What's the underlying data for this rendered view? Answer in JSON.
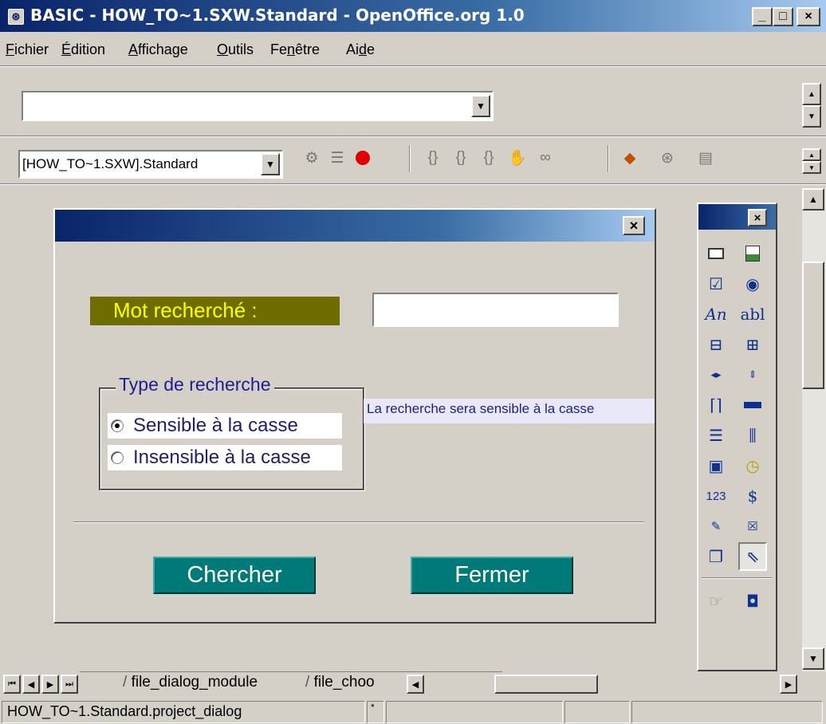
{
  "window": {
    "title": "BASIC - HOW_TO~1.SXW.Standard - OpenOffice.org 1.0",
    "minimize_icon": "_",
    "maximize_icon": "□",
    "close_icon": "×"
  },
  "menu": {
    "items": [
      {
        "mnemonic": "F",
        "rest": "ichier"
      },
      {
        "mnemonic": "É",
        "rest": "dition"
      },
      {
        "mnemonic": "A",
        "rest": "ffichage"
      },
      {
        "mnemonic": "O",
        "rest": "utils"
      },
      {
        "pre": "Fe",
        "mnemonic": "n",
        "rest": "être"
      },
      {
        "pre": "Ai",
        "mnemonic": "d",
        "rest": "e"
      }
    ]
  },
  "url_bar": {
    "value": ""
  },
  "basic_toolbar": {
    "library_value": "[HOW_TO~1.SXW].Standard",
    "icons": [
      "compile-icon",
      "run-icon",
      "stop-icon",
      "step-into-icon",
      "step-over-icon",
      "step-out-icon",
      "breakpoint-icon",
      "watch-icon",
      "macros-icon",
      "modules-icon",
      "dialog-icon"
    ]
  },
  "dialog": {
    "close_icon": "×",
    "search_label": "Mot recherché :",
    "search_value": "",
    "group_title": "Type de recherche",
    "option_sensitive": "Sensible à la casse",
    "option_insensitive": "Insensible à la casse",
    "selected_option": "sensitive",
    "info_text": "La recherche sera sensible à la casse",
    "search_button": "Chercher",
    "close_button": "Fermer",
    "button_color": "#007a78",
    "label_color": "#6e6e00"
  },
  "toolbox": {
    "close_icon": "×",
    "tools": [
      "button-tool-icon",
      "image-control-icon",
      "checkbox-icon",
      "option-button-icon",
      "label-field-icon",
      "text-box-icon",
      "list-box-icon",
      "combo-box-icon",
      "h-scrollbar-icon",
      "v-scrollbar-icon",
      "group-box-icon",
      "progress-bar-icon",
      "h-line-icon",
      "v-line-icon",
      "date-field-icon",
      "time-field-icon",
      "numeric-field-icon",
      "currency-field-icon",
      "formatted-field-icon",
      "pattern-field-icon",
      "file-selection-icon",
      "select-pointer-icon",
      "properties-icon",
      "activate-test-mode-icon"
    ],
    "text_glyphs": {
      "label": "An",
      "textbox": "abl",
      "numeric": "123"
    }
  },
  "tabs": {
    "items": [
      "file_dialog_module",
      "file_choo"
    ]
  },
  "status": {
    "object_path": "HOW_TO~1.Standard.project_dialog",
    "modified_marker": "*"
  }
}
